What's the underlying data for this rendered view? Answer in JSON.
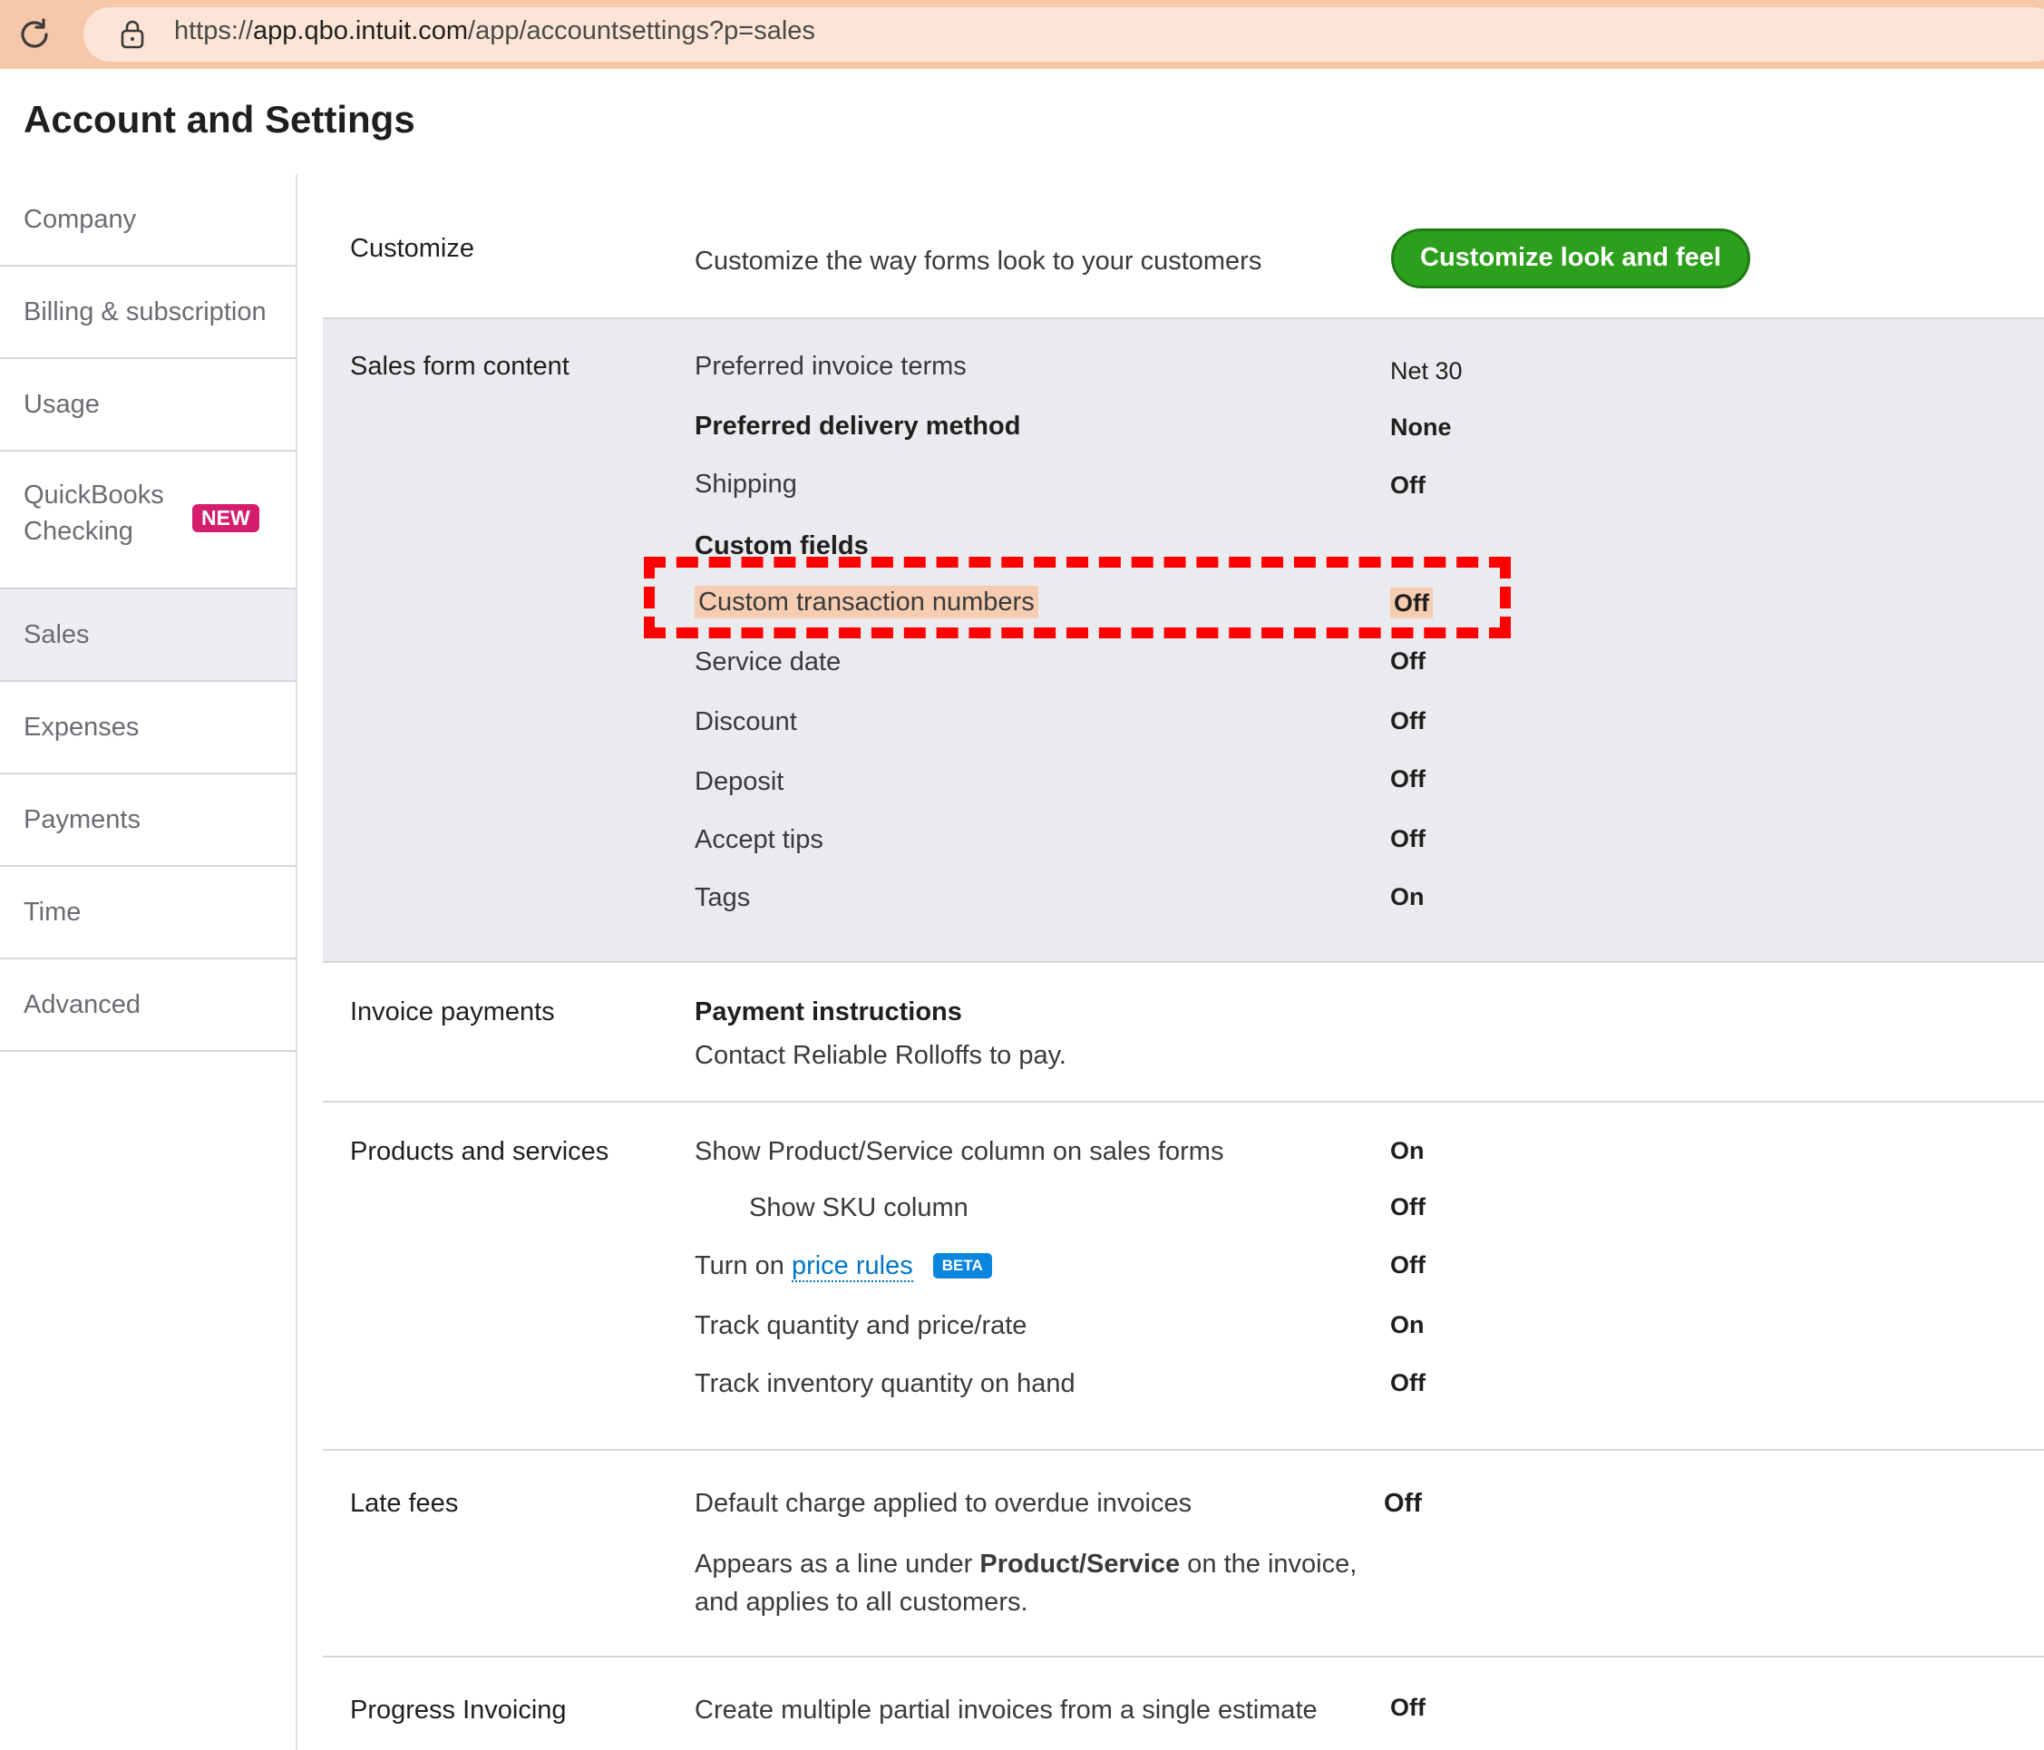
{
  "browser": {
    "url_scheme": "https://",
    "url_host": "app.qbo.intuit.com",
    "url_path": "/app/accountsettings?p=sales",
    "reload_icon": "reload-icon",
    "lock_icon": "lock-icon"
  },
  "page": {
    "title": "Account and Settings"
  },
  "sidebar": {
    "items": [
      {
        "label": "Company"
      },
      {
        "label": "Billing & subscription"
      },
      {
        "label": "Usage"
      },
      {
        "label_line1": "QuickBooks",
        "label_line2": "Checking",
        "badge": "NEW"
      },
      {
        "label": "Sales",
        "active": true
      },
      {
        "label": "Expenses"
      },
      {
        "label": "Payments"
      },
      {
        "label": "Time"
      },
      {
        "label": "Advanced"
      }
    ]
  },
  "customize": {
    "title": "Customize",
    "description": "Customize the way forms look to your customers",
    "button_label": "Customize look and feel"
  },
  "sales_form_content": {
    "title": "Sales form content",
    "rows": [
      {
        "label": "Preferred invoice terms",
        "value": "Net 30"
      },
      {
        "label": "Preferred delivery method",
        "value": "None"
      },
      {
        "label": "Shipping",
        "value": "Off"
      },
      {
        "label": "Custom fields",
        "value": ""
      },
      {
        "label": "Custom transaction numbers",
        "value": "Off"
      },
      {
        "label": "Service date",
        "value": "Off"
      },
      {
        "label": "Discount",
        "value": "Off"
      },
      {
        "label": "Deposit",
        "value": "Off"
      },
      {
        "label": "Accept tips",
        "value": "Off"
      },
      {
        "label": "Tags",
        "value": "On"
      }
    ]
  },
  "invoice_payments": {
    "title": "Invoice payments",
    "heading": "Payment instructions",
    "text": "Contact Reliable Rolloffs to pay."
  },
  "products_services": {
    "title": "Products and services",
    "rows": [
      {
        "label": "Show Product/Service column on sales forms",
        "value": "On"
      },
      {
        "label": "Show SKU column",
        "value": "Off"
      },
      {
        "label_prefix": "Turn on",
        "link": "price rules",
        "badge": "BETA",
        "value": "Off"
      },
      {
        "label": "Track quantity and price/rate",
        "value": "On"
      },
      {
        "label": "Track inventory quantity on hand",
        "value": "Off"
      }
    ]
  },
  "late_fees": {
    "title": "Late fees",
    "description": "Default charge applied to overdue invoices",
    "value": "Off",
    "note_prefix": "Appears as a line under",
    "note_bold": "Product/Service",
    "note_suffix": "on the invoice,",
    "note_line2": "and applies to all customers."
  },
  "progress_invoicing": {
    "title": "Progress Invoicing",
    "description": "Create multiple partial invoices from a single estimate",
    "value": "Off"
  },
  "colors": {
    "accent_green": "#2ca01c",
    "new_badge": "#d51d6d",
    "beta_badge": "#0a85e0",
    "link": "#0077c5",
    "highlight": "#f7cdb1",
    "annotation_red": "#ff0000"
  }
}
